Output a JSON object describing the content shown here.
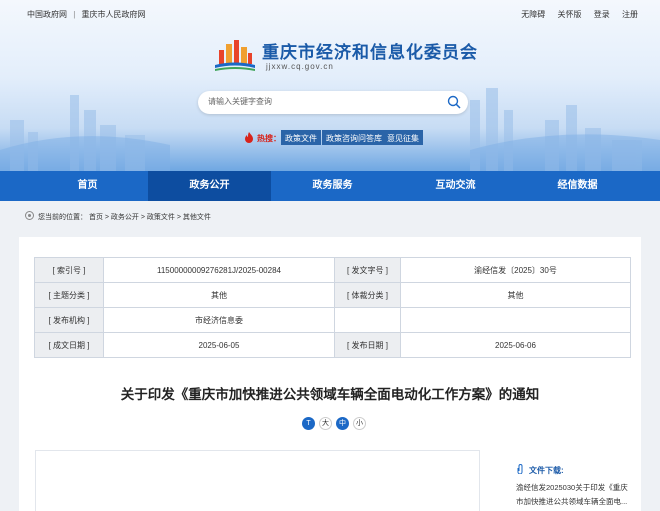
{
  "topbar": {
    "links_left": [
      "中国政府网",
      "重庆市人民政府网"
    ],
    "separator": "|",
    "links_right": [
      "无障碍",
      "关怀版",
      "登录",
      "注册"
    ]
  },
  "site": {
    "title": "重庆市经济和信息化委员会",
    "url": "jjxxw.cq.gov.cn"
  },
  "search": {
    "placeholder": "请输入关键字查询"
  },
  "hot": {
    "label": "热搜：",
    "tags": [
      "政策文件",
      "政策咨询问答库",
      "意见征集"
    ]
  },
  "nav": {
    "items": [
      "首页",
      "政务公开",
      "政务服务",
      "互动交流",
      "经信数据"
    ],
    "active": 1
  },
  "breadcrumb": {
    "text": "您当前的位置： 首页 > 政务公开 > 政策文件 > 其他文件"
  },
  "meta": {
    "rows": [
      [
        "[ 索引号 ]",
        "11500000009276281J/2025-00284",
        "[ 发文字号 ]",
        "渝经信发〔2025〕30号"
      ],
      [
        "[ 主题分类 ]",
        "其他",
        "[ 体裁分类 ]",
        "其他"
      ],
      [
        "[ 发布机构 ]",
        "市经济信息委",
        "",
        ""
      ],
      [
        "[ 成文日期 ]",
        "2025-06-05",
        "[ 发布日期 ]",
        "2025-06-06"
      ]
    ]
  },
  "document": {
    "title": "关于印发《重庆市加快推进公共领域车辆全面电动化工作方案》的通知"
  },
  "font_size": {
    "buttons": [
      "T",
      "大",
      "中",
      "小"
    ]
  },
  "download": {
    "title": "文件下载:",
    "lines": [
      "渝经信发2025030关于印发《重庆",
      "市加快推进公共领域车辆全面电..."
    ]
  },
  "colors": {
    "brand_blue": "#1b68c6",
    "nav_active": "#0d4da0",
    "hot_red": "#d8231b"
  }
}
